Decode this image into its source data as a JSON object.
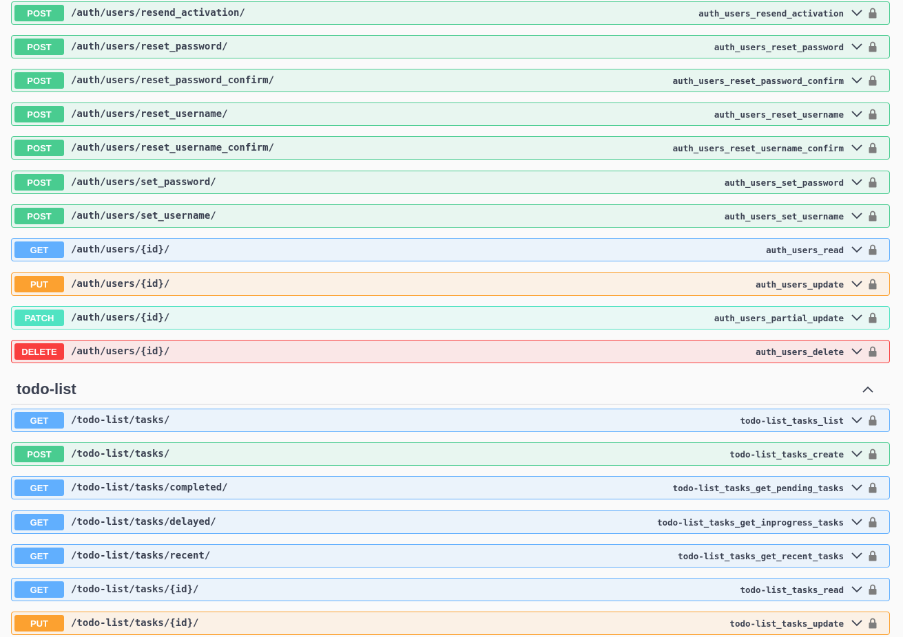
{
  "colors": {
    "post": "#49cc90",
    "get": "#61affe",
    "put": "#fca130",
    "patch": "#50e3c2",
    "delete": "#f93e3e",
    "text": "#3b4151"
  },
  "icons": {
    "expand": "chevron-down-icon",
    "collapse": "chevron-up-icon",
    "auth": "lock-icon"
  },
  "auth_operations": [
    {
      "method": "POST",
      "path": "/auth/users/resend_activation/",
      "operation_id": "auth_users_resend_activation"
    },
    {
      "method": "POST",
      "path": "/auth/users/reset_password/",
      "operation_id": "auth_users_reset_password"
    },
    {
      "method": "POST",
      "path": "/auth/users/reset_password_confirm/",
      "operation_id": "auth_users_reset_password_confirm"
    },
    {
      "method": "POST",
      "path": "/auth/users/reset_username/",
      "operation_id": "auth_users_reset_username"
    },
    {
      "method": "POST",
      "path": "/auth/users/reset_username_confirm/",
      "operation_id": "auth_users_reset_username_confirm"
    },
    {
      "method": "POST",
      "path": "/auth/users/set_password/",
      "operation_id": "auth_users_set_password"
    },
    {
      "method": "POST",
      "path": "/auth/users/set_username/",
      "operation_id": "auth_users_set_username"
    },
    {
      "method": "GET",
      "path": "/auth/users/{id}/",
      "operation_id": "auth_users_read"
    },
    {
      "method": "PUT",
      "path": "/auth/users/{id}/",
      "operation_id": "auth_users_update"
    },
    {
      "method": "PATCH",
      "path": "/auth/users/{id}/",
      "operation_id": "auth_users_partial_update"
    },
    {
      "method": "DELETE",
      "path": "/auth/users/{id}/",
      "operation_id": "auth_users_delete"
    }
  ],
  "todo_section": {
    "title": "todo-list"
  },
  "todo_operations": [
    {
      "method": "GET",
      "path": "/todo-list/tasks/",
      "operation_id": "todo-list_tasks_list"
    },
    {
      "method": "POST",
      "path": "/todo-list/tasks/",
      "operation_id": "todo-list_tasks_create"
    },
    {
      "method": "GET",
      "path": "/todo-list/tasks/completed/",
      "operation_id": "todo-list_tasks_get_pending_tasks"
    },
    {
      "method": "GET",
      "path": "/todo-list/tasks/delayed/",
      "operation_id": "todo-list_tasks_get_inprogress_tasks"
    },
    {
      "method": "GET",
      "path": "/todo-list/tasks/recent/",
      "operation_id": "todo-list_tasks_get_recent_tasks"
    },
    {
      "method": "GET",
      "path": "/todo-list/tasks/{id}/",
      "operation_id": "todo-list_tasks_read"
    },
    {
      "method": "PUT",
      "path": "/todo-list/tasks/{id}/",
      "operation_id": "todo-list_tasks_update"
    }
  ]
}
